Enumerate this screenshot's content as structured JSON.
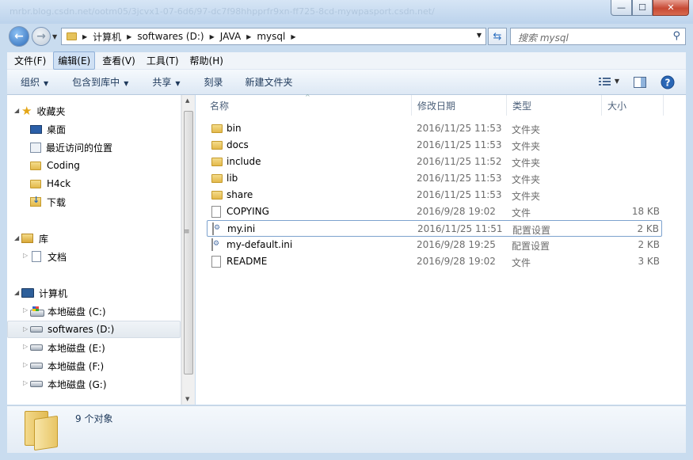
{
  "window": {
    "title_ghost": "mrbr.blog.csdn.net/ootm05/3jcvx1-07-6d6/97-dc7f98hhpprfr9xn-ff725-8cd-mywpasport.csdn.net/",
    "minimize_label": "—",
    "maximize_label": "☐",
    "close_label": "✕"
  },
  "address": {
    "breadcrumbs": [
      "计算机",
      "softwares (D:)",
      "JAVA",
      "mysql"
    ]
  },
  "search": {
    "placeholder": "搜索 mysql"
  },
  "menu": [
    "文件(F)",
    "编辑(E)",
    "查看(V)",
    "工具(T)",
    "帮助(H)"
  ],
  "toolbar": {
    "organize": "组织",
    "include_in_library": "包含到库中",
    "share": "共享",
    "burn": "刻录",
    "new_folder": "新建文件夹"
  },
  "nav": {
    "favorites": {
      "label": "收藏夹",
      "items": [
        "桌面",
        "最近访问的位置",
        "Coding",
        "H4ck",
        "下载"
      ]
    },
    "libraries": {
      "label": "库",
      "items": [
        "文档"
      ]
    },
    "computer": {
      "label": "计算机",
      "drives": [
        "本地磁盘 (C:)",
        "softwares (D:)",
        "本地磁盘 (E:)",
        "本地磁盘 (F:)",
        "本地磁盘 (G:)"
      ]
    }
  },
  "columns": {
    "name": "名称",
    "date": "修改日期",
    "type": "类型",
    "size": "大小"
  },
  "files": [
    {
      "name": "bin",
      "date": "2016/11/25 11:53",
      "type": "文件夹",
      "size": "",
      "icon": "folder-icon"
    },
    {
      "name": "docs",
      "date": "2016/11/25 11:53",
      "type": "文件夹",
      "size": "",
      "icon": "folder-icon"
    },
    {
      "name": "include",
      "date": "2016/11/25 11:52",
      "type": "文件夹",
      "size": "",
      "icon": "folder-icon"
    },
    {
      "name": "lib",
      "date": "2016/11/25 11:53",
      "type": "文件夹",
      "size": "",
      "icon": "folder-icon"
    },
    {
      "name": "share",
      "date": "2016/11/25 11:53",
      "type": "文件夹",
      "size": "",
      "icon": "folder-icon"
    },
    {
      "name": "COPYING",
      "date": "2016/9/28 19:02",
      "type": "文件",
      "size": "18 KB",
      "icon": "file-icon"
    },
    {
      "name": "my.ini",
      "date": "2016/11/25 11:51",
      "type": "配置设置",
      "size": "2 KB",
      "icon": "ini-file-icon"
    },
    {
      "name": "my-default.ini",
      "date": "2016/9/28 19:25",
      "type": "配置设置",
      "size": "2 KB",
      "icon": "ini-file-icon"
    },
    {
      "name": "README",
      "date": "2016/9/28 19:02",
      "type": "文件",
      "size": "3 KB",
      "icon": "file-icon"
    }
  ],
  "status": {
    "item_count": "9 个对象"
  }
}
